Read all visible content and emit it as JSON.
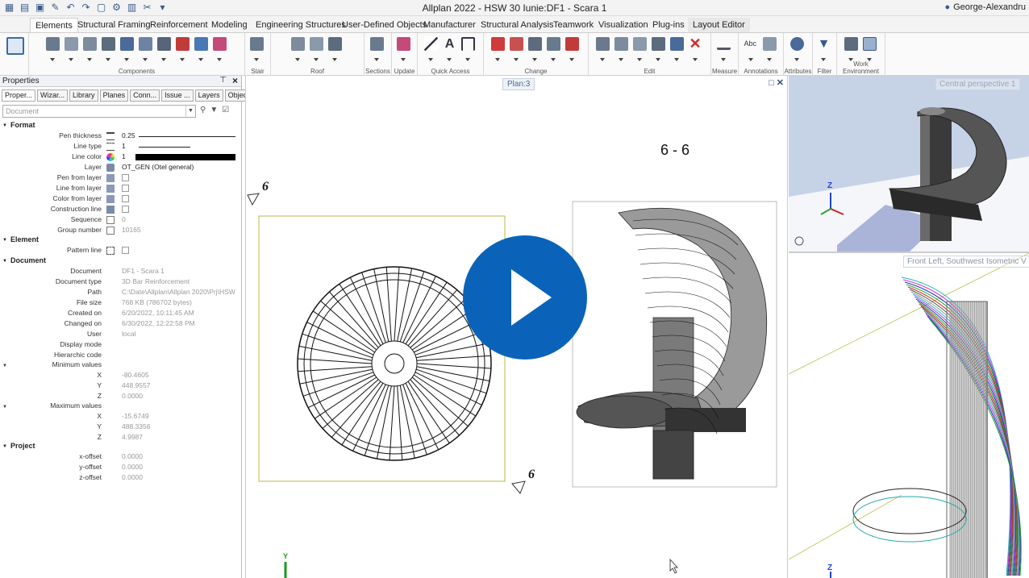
{
  "app": {
    "title": "Allplan 2022 - HSW 30 Iunie:DF1 - Scara 1",
    "user": "George-Alexandru"
  },
  "ribbon": {
    "tabs": [
      {
        "label": "Elements",
        "active": true
      },
      {
        "label": "Structural Framing"
      },
      {
        "label": "Reinforcement"
      },
      {
        "label": "Modeling"
      },
      {
        "label": "Engineering Structures"
      },
      {
        "label": "User-Defined Objects"
      },
      {
        "label": "Manufacturer"
      },
      {
        "label": "Structural Analysis"
      },
      {
        "label": "Teamwork"
      },
      {
        "label": "Visualization"
      },
      {
        "label": "Plug-ins"
      },
      {
        "label": "Layout Editor"
      }
    ],
    "groups": [
      {
        "label": "Components"
      },
      {
        "label": "Stair"
      },
      {
        "label": "Roof"
      },
      {
        "label": "Sections"
      },
      {
        "label": "Update"
      },
      {
        "label": "Quick Access"
      },
      {
        "label": "Change"
      },
      {
        "label": "Edit"
      },
      {
        "label": "Measure"
      },
      {
        "label": "Annotations"
      },
      {
        "label": "Attributes"
      },
      {
        "label": "Filter"
      },
      {
        "label": "Work Environment"
      }
    ]
  },
  "properties": {
    "title": "Properties",
    "tabs": [
      "Proper...",
      "Wizar...",
      "Library",
      "Planes",
      "Conn...",
      "Issue ...",
      "Layers",
      "Objects"
    ],
    "selector_placeholder": "Document",
    "format": {
      "title": "Format",
      "pen_thickness": {
        "label": "Pen thickness",
        "value": "0.25"
      },
      "line_type": {
        "label": "Line type",
        "value": "1"
      },
      "line_color": {
        "label": "Line color",
        "value": "1"
      },
      "layer": {
        "label": "Layer",
        "value": "OT_GEN (Otel general)"
      },
      "pen_from_layer": {
        "label": "Pen from layer"
      },
      "line_from_layer": {
        "label": "Line from layer"
      },
      "color_from_layer": {
        "label": "Color from layer"
      },
      "construction_line": {
        "label": "Construction line"
      },
      "sequence": {
        "label": "Sequence",
        "value": "0"
      },
      "group_number": {
        "label": "Group number",
        "value": "10165"
      }
    },
    "element": {
      "title": "Element",
      "pattern_line": {
        "label": "Pattern line"
      }
    },
    "document": {
      "title": "Document",
      "document": {
        "label": "Document",
        "value": "DF1 - Scara 1"
      },
      "document_type": {
        "label": "Document type",
        "value": "3D Bar Reinforcement"
      },
      "path": {
        "label": "Path",
        "value": "C:\\Date\\Allplan\\Allplan 2020\\Prj\\HSW"
      },
      "file_size": {
        "label": "File size",
        "value": "768 KB (786702 bytes)"
      },
      "created_on": {
        "label": "Created on",
        "value": "6/20/2022, 10:11:45 AM"
      },
      "changed_on": {
        "label": "Changed on",
        "value": "6/30/2022, 12:22:58 PM"
      },
      "user": {
        "label": "User",
        "value": "local"
      },
      "display_mode": {
        "label": "Display mode"
      },
      "hierarchic_code": {
        "label": "Hierarchic code"
      },
      "min_values": {
        "label": "Minimum values",
        "x": "-80.4605",
        "y": "448.9557",
        "z": "0.0000"
      },
      "max_values": {
        "label": "Maximum values",
        "x": "-15.6749",
        "y": "488.3356",
        "z": "4.9987"
      }
    },
    "project": {
      "title": "Project",
      "x_offset": {
        "label": "x-offset",
        "value": "0.0000"
      },
      "y_offset": {
        "label": "y-offset",
        "value": "0.0000"
      },
      "z_offset": {
        "label": "z-offset",
        "value": "0.0000"
      }
    },
    "axis": {
      "x": "X",
      "y": "Y",
      "z": "Z"
    }
  },
  "plan_view": {
    "tab_label": "Plan:3",
    "section_label": "6 - 6",
    "section_mark": "6"
  },
  "view_top": {
    "label": "Central perspective 1"
  },
  "view_bottom": {
    "label": "Front Left, Southwest Isometric V"
  },
  "colors": {
    "accent": "#0a63b8",
    "viewport_bg": "#c6d3e6"
  }
}
